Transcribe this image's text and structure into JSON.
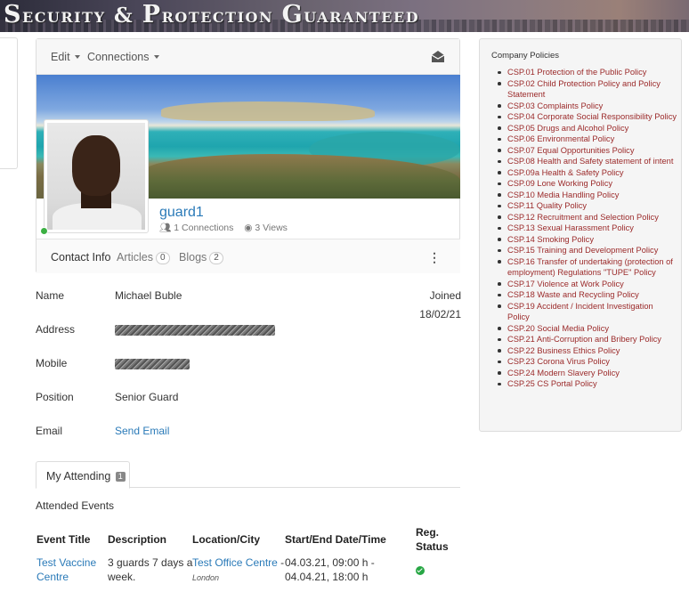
{
  "banner": {
    "title_first": "S",
    "title_rest": "ecurity & ",
    "title_p": "P",
    "title_rest2": "rotection ",
    "title_g": "G",
    "title_rest3": "uaranteed"
  },
  "toolbar": {
    "edit": "Edit",
    "connections": "Connections",
    "icon": "envelope-open-icon"
  },
  "profile": {
    "username": "guard1",
    "connections": "1 Connections",
    "views": "3 Views",
    "tabs": [
      {
        "label": "Contact Info",
        "count": ""
      },
      {
        "label": "Articles",
        "count": "0"
      },
      {
        "label": "Blogs",
        "count": "2"
      }
    ]
  },
  "details": {
    "name_label": "Name",
    "name_value": "Michael Buble",
    "address_label": "Address",
    "mobile_label": "Mobile",
    "position_label": "Position",
    "position_value": "Senior Guard",
    "email_label": "Email",
    "email_value": "Send Email",
    "joined_label": "Joined",
    "joined_value": "18/02/21"
  },
  "attending": {
    "tab_label": "My Attending",
    "tab_count": "1",
    "heading": "Attended Events",
    "columns": [
      "Event Title",
      "Description",
      "Location/City",
      "Start/End Date/Time",
      "Reg.",
      "Status"
    ],
    "rows": [
      {
        "title_line1": "Test Vaccine",
        "title_line2": "Centre",
        "desc_line1": "3 guards 7 days a",
        "desc_line2": "week.",
        "location": "Test Office Centre",
        "location_suffix": " -",
        "city": "London",
        "start": "04.03.21, 09:00 h -",
        "end": "04.04.21, 18:00 h"
      }
    ]
  },
  "policies": {
    "title": "Company Policies",
    "items": [
      "CSP.01 Protection of the Public Policy",
      "CSP.02 Child Protection Policy and Policy Statement",
      "CSP.03 Complaints Policy",
      "CSP.04 Corporate Social Responsibility Policy",
      "CSP.05 Drugs and Alcohol Policy",
      "CSP.06 Environmental Policy",
      "CSP.07 Equal Opportunities Policy",
      "CSP.08 Health and Safety statement of intent",
      "CSP.09a Health & Safety Policy",
      "CSP.09 Lone Working Policy",
      "CSP.10 Media Handling Policy",
      "CSP.11 Quality Policy",
      "CSP.12 Recruitment and Selection Policy",
      "CSP.13 Sexual Harassment Policy",
      "CSP.14 Smoking Policy",
      "CSP.15 Training and Development Policy",
      "CSP.16 Transfer of undertaking (protection of employment) Regulations \"TUPE\" Policy",
      "CSP.17 Violence at Work Policy",
      "CSP.18 Waste and Recycling Policy",
      "CSP.19 Accident / Incident Investigation Policy",
      "CSP.20 Social Media Policy",
      "CSP.21 Anti-Corruption and Bribery Policy",
      "CSP.22 Business Ethics Policy",
      "CSP.23 Corona Virus Policy",
      "CSP.24 Modern Slavery Policy",
      "CSP.25 CS Portal Policy"
    ]
  }
}
